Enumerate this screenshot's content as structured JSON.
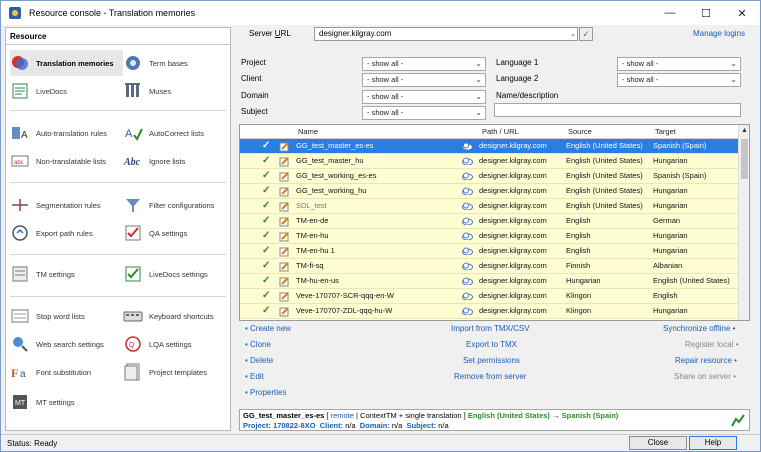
{
  "window": {
    "title": "Resource console - Translation memories",
    "minimize": "—",
    "maximize": "☐",
    "close": "✕"
  },
  "left": {
    "header": "Resource",
    "items": [
      [
        "Translation memories",
        "Term bases"
      ],
      [
        "LiveDocs",
        "Muses"
      ],
      [
        "Auto-translation rules",
        "AutoCorrect lists"
      ],
      [
        "Non-translatable lists",
        "Ignore lists"
      ],
      [
        "Segmentation rules",
        "Filter configurations"
      ],
      [
        "Export path rules",
        "QA settings"
      ],
      [
        "TM settings",
        "LiveDocs settings"
      ],
      [
        "Stop word lists",
        "Keyboard shortcuts"
      ],
      [
        "Web search settings",
        "LQA settings"
      ],
      [
        "Font substitution",
        "Project templates"
      ],
      [
        "MT settings",
        ""
      ]
    ]
  },
  "server": {
    "label_pre": "Server ",
    "label_u": "U",
    "label_post": "RL",
    "value": "designer.kilgray.com",
    "manage": "Manage logins"
  },
  "filters": {
    "project_label": "Project",
    "client_label": "Client",
    "domain_label": "Domain",
    "subject_label": "Subject",
    "lang1_label": "Language 1",
    "lang2_label": "Language 2",
    "name_label": "Name/description",
    "show_all": "- show all -"
  },
  "table": {
    "columns": [
      "Name",
      "Path / URL",
      "Source",
      "Target"
    ],
    "rows": [
      {
        "name": "GG_test_master_es-es",
        "url": "designer.kilgray.com",
        "source": "English (United States)",
        "target": "Spanish (Spain)"
      },
      {
        "name": "GG_test_master_hu",
        "url": "designer.kilgray.com",
        "source": "English (United States)",
        "target": "Hungarian"
      },
      {
        "name": "GG_test_working_es-es",
        "url": "designer.kilgray.com",
        "source": "English (United States)",
        "target": "Spanish (Spain)"
      },
      {
        "name": "GG_test_working_hu",
        "url": "designer.kilgray.com",
        "source": "English (United States)",
        "target": "Hungarian"
      },
      {
        "name": "SDL_test",
        "url": "designer.kilgray.com",
        "source": "English (United States)",
        "target": "Hungarian"
      },
      {
        "name": "TM-en-de",
        "url": "designer.kilgray.com",
        "source": "English",
        "target": "German"
      },
      {
        "name": "TM-en-hu",
        "url": "designer.kilgray.com",
        "source": "English",
        "target": "Hungarian"
      },
      {
        "name": "TM-en-hu 1",
        "url": "designer.kilgray.com",
        "source": "English",
        "target": "Hungarian"
      },
      {
        "name": "TM-fi-sq",
        "url": "designer.kilgray.com",
        "source": "Finnish",
        "target": "Albanian"
      },
      {
        "name": "TM-hu-en-us",
        "url": "designer.kilgray.com",
        "source": "Hungarian",
        "target": "English (United States)"
      },
      {
        "name": "Veve-170707-SCR-qqq-en-W",
        "url": "designer.kilgray.com",
        "source": "Klingon",
        "target": "English"
      },
      {
        "name": "Veve-170707-ZDL-qqq-hu-W",
        "url": "designer.kilgray.com",
        "source": "Klingon",
        "target": "Hungarian"
      }
    ]
  },
  "actions": {
    "create": "• Create new",
    "clone": "• Clone",
    "delete": "• Delete",
    "edit": "• Edit",
    "properties": "• Properties",
    "import": "Import from TMX/CSV",
    "export": "Export to TMX",
    "permissions": "Set permissions",
    "remove": "Remove from server",
    "sync": "Synchronize offline •",
    "register": "Register local •",
    "repair": "Repair resource •",
    "share": "Share on server •"
  },
  "info": {
    "name": "GG_test_master_es-es",
    "remote": "remote",
    "context": "ContextTM + single translation",
    "src": "English (United States)",
    "arrow": "→",
    "tgt": "Spanish (Spain)",
    "project_label": "Project:",
    "project_value": "170822-8XO",
    "client_label": "Client:",
    "client_value": "n/a",
    "domain_label": "Domain:",
    "domain_value": "n/a",
    "subject_label": "Subject:",
    "subject_value": "n/a"
  },
  "status": {
    "text": "Status: Ready",
    "close": "Close",
    "help": "Help"
  },
  "colors": {
    "row_bg": "#fefed2",
    "selected": "#2a7de1",
    "link": "#1a5fb4"
  }
}
